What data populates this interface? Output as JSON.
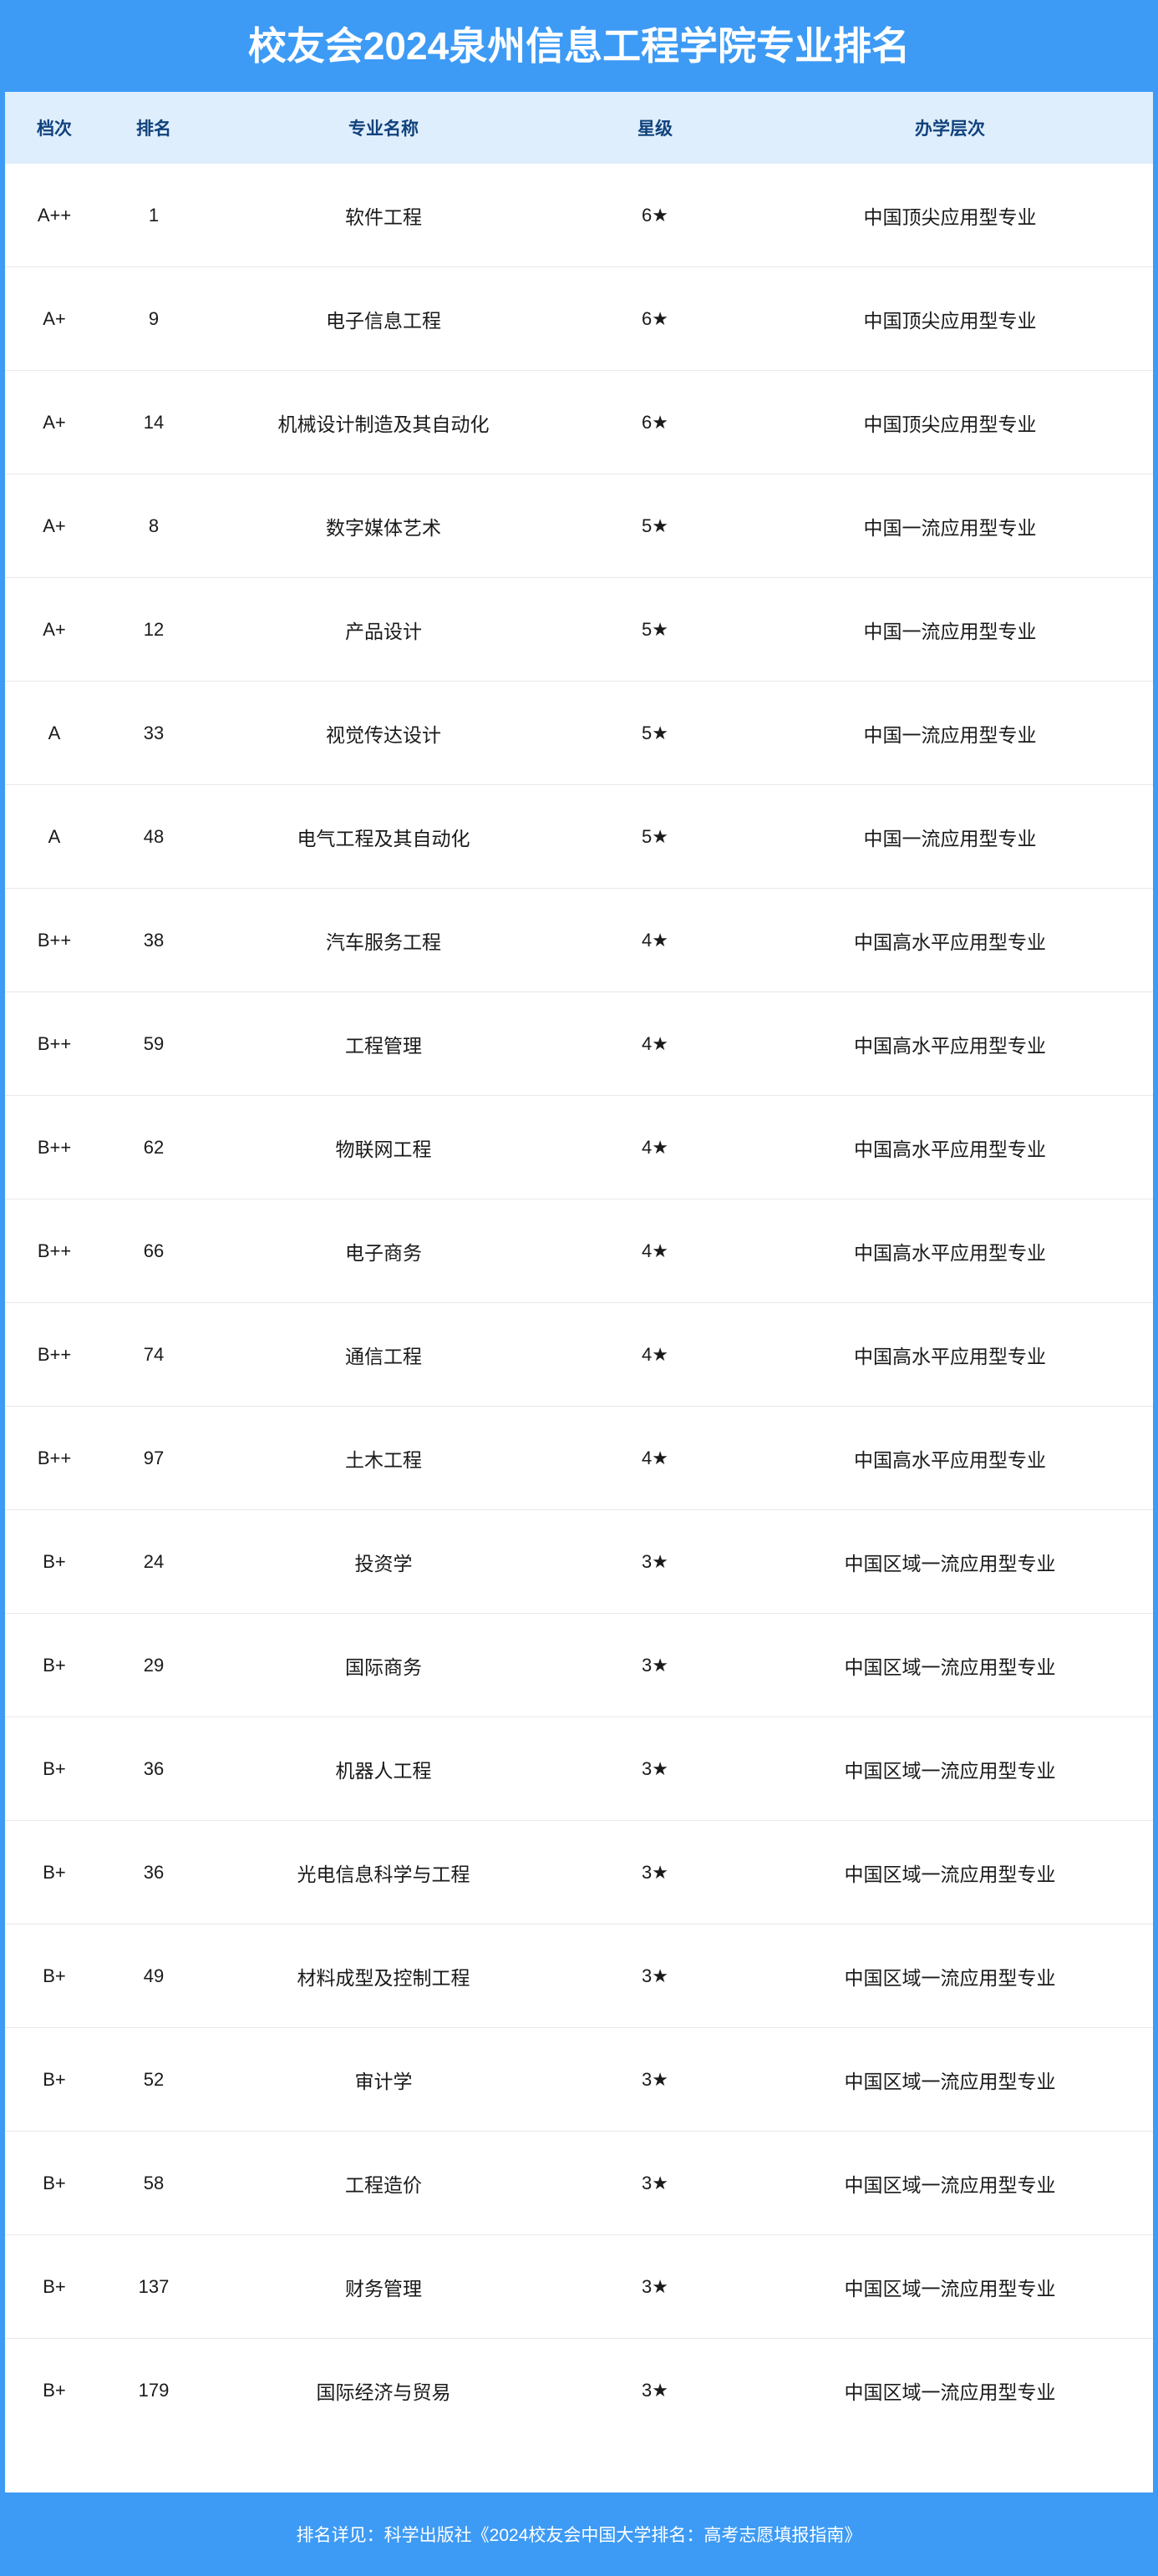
{
  "header": {
    "title": "校友会2024泉州信息工程学院专业排名",
    "background_color": "#3d9bf5",
    "text_color": "#ffffff"
  },
  "table": {
    "header_background": "#dfeefc",
    "header_text_color": "#10427c",
    "columns": [
      {
        "key": "tier",
        "label": "档次"
      },
      {
        "key": "rank",
        "label": "排名"
      },
      {
        "key": "major",
        "label": "专业名称"
      },
      {
        "key": "star",
        "label": "星级"
      },
      {
        "key": "level",
        "label": "办学层次"
      }
    ],
    "rows": [
      {
        "tier": "A++",
        "rank": "1",
        "major": "软件工程",
        "star": "6★",
        "level": "中国顶尖应用型专业"
      },
      {
        "tier": "A+",
        "rank": "9",
        "major": "电子信息工程",
        "star": "6★",
        "level": "中国顶尖应用型专业"
      },
      {
        "tier": "A+",
        "rank": "14",
        "major": "机械设计制造及其自动化",
        "star": "6★",
        "level": "中国顶尖应用型专业"
      },
      {
        "tier": "A+",
        "rank": "8",
        "major": "数字媒体艺术",
        "star": "5★",
        "level": "中国一流应用型专业"
      },
      {
        "tier": "A+",
        "rank": "12",
        "major": "产品设计",
        "star": "5★",
        "level": "中国一流应用型专业"
      },
      {
        "tier": "A",
        "rank": "33",
        "major": "视觉传达设计",
        "star": "5★",
        "level": "中国一流应用型专业"
      },
      {
        "tier": "A",
        "rank": "48",
        "major": "电气工程及其自动化",
        "star": "5★",
        "level": "中国一流应用型专业"
      },
      {
        "tier": "B++",
        "rank": "38",
        "major": "汽车服务工程",
        "star": "4★",
        "level": "中国高水平应用型专业"
      },
      {
        "tier": "B++",
        "rank": "59",
        "major": "工程管理",
        "star": "4★",
        "level": "中国高水平应用型专业"
      },
      {
        "tier": "B++",
        "rank": "62",
        "major": "物联网工程",
        "star": "4★",
        "level": "中国高水平应用型专业"
      },
      {
        "tier": "B++",
        "rank": "66",
        "major": "电子商务",
        "star": "4★",
        "level": "中国高水平应用型专业"
      },
      {
        "tier": "B++",
        "rank": "74",
        "major": "通信工程",
        "star": "4★",
        "level": "中国高水平应用型专业"
      },
      {
        "tier": "B++",
        "rank": "97",
        "major": "土木工程",
        "star": "4★",
        "level": "中国高水平应用型专业"
      },
      {
        "tier": "B+",
        "rank": "24",
        "major": "投资学",
        "star": "3★",
        "level": "中国区域一流应用型专业"
      },
      {
        "tier": "B+",
        "rank": "29",
        "major": "国际商务",
        "star": "3★",
        "level": "中国区域一流应用型专业"
      },
      {
        "tier": "B+",
        "rank": "36",
        "major": "机器人工程",
        "star": "3★",
        "level": "中国区域一流应用型专业"
      },
      {
        "tier": "B+",
        "rank": "36",
        "major": "光电信息科学与工程",
        "star": "3★",
        "level": "中国区域一流应用型专业"
      },
      {
        "tier": "B+",
        "rank": "49",
        "major": "材料成型及控制工程",
        "star": "3★",
        "level": "中国区域一流应用型专业"
      },
      {
        "tier": "B+",
        "rank": "52",
        "major": "审计学",
        "star": "3★",
        "level": "中国区域一流应用型专业"
      },
      {
        "tier": "B+",
        "rank": "58",
        "major": "工程造价",
        "star": "3★",
        "level": "中国区域一流应用型专业"
      },
      {
        "tier": "B+",
        "rank": "137",
        "major": "财务管理",
        "star": "3★",
        "level": "中国区域一流应用型专业"
      },
      {
        "tier": "B+",
        "rank": "179",
        "major": "国际经济与贸易",
        "star": "3★",
        "level": "中国区域一流应用型专业"
      }
    ]
  },
  "footer": {
    "note": "排名详见：科学出版社《2024校友会中国大学排名：高考志愿填报指南》",
    "background_color": "#3d9bf5",
    "text_color": "#ffffff"
  }
}
